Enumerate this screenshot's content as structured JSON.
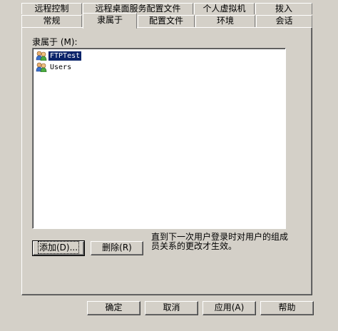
{
  "tabs_row1": [
    {
      "label": "远程控制"
    },
    {
      "label": "远程桌面服务配置文件"
    },
    {
      "label": "个人虚拟机"
    },
    {
      "label": "拨入"
    }
  ],
  "tabs_row2": [
    {
      "label": "常规"
    },
    {
      "label": "隶属于"
    },
    {
      "label": "配置文件"
    },
    {
      "label": "环境"
    },
    {
      "label": "会话"
    }
  ],
  "member_of": {
    "label": "隶属于 (M):",
    "items": [
      {
        "name": "FTPTest",
        "selected": true
      },
      {
        "name": "Users",
        "selected": false
      }
    ]
  },
  "buttons": {
    "add": "添加(D)...",
    "remove": "删除(R)"
  },
  "note": "直到下一次用户登录时对用户的组成员关系的更改才生效。",
  "footer": {
    "ok": "确定",
    "cancel": "取消",
    "apply": "应用(A)",
    "help": "帮助"
  }
}
